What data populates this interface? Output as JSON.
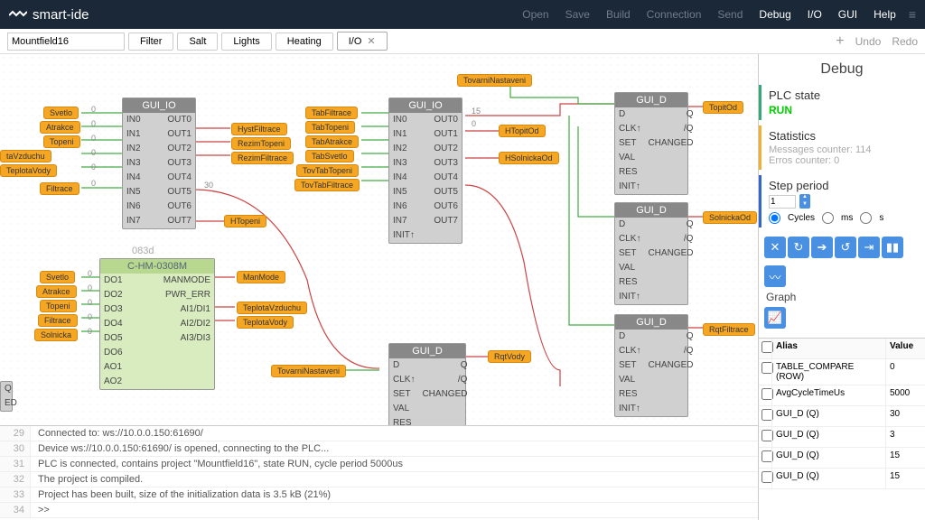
{
  "app": {
    "name": "smart-ide"
  },
  "menu": [
    "Open",
    "Save",
    "Build",
    "Connection",
    "Send",
    "Debug",
    "I/O",
    "GUI",
    "Help"
  ],
  "menu_active": "Debug",
  "project_name": "Mountfield16",
  "tabs": [
    "Filter",
    "Salt",
    "Lights",
    "Heating",
    "I/O"
  ],
  "active_tab": "I/O",
  "toolbar_right": {
    "plus": "+",
    "undo": "Undo",
    "redo": "Redo"
  },
  "blocks": {
    "gui_io_1": {
      "title": "GUI_IO",
      "left": [
        "IN0",
        "IN1",
        "IN2",
        "IN3",
        "IN4",
        "IN5",
        "IN6",
        "IN7"
      ],
      "right": [
        "OUT0",
        "OUT1",
        "OUT2",
        "OUT3",
        "OUT4",
        "OUT5",
        "OUT6",
        "OUT7"
      ]
    },
    "gui_io_2": {
      "title": "GUI_IO",
      "left": [
        "IN0",
        "IN1",
        "IN2",
        "IN3",
        "IN4",
        "IN5",
        "IN6",
        "IN7",
        "INIT↑"
      ],
      "right": [
        "OUT0",
        "OUT1",
        "OUT2",
        "OUT3",
        "OUT4",
        "OUT5",
        "OUT6",
        "OUT7",
        ""
      ]
    },
    "gui_d": {
      "title": "GUI_D",
      "left": [
        "D",
        "CLK↑",
        "SET",
        "VAL",
        "RES",
        "INIT↑"
      ],
      "right": [
        "Q",
        "/Q",
        "CHANGED",
        "",
        "",
        ""
      ]
    },
    "chm": {
      "title": "C-HM-0308M",
      "sub": "083d",
      "left": [
        "DO1",
        "DO2",
        "DO3",
        "DO4",
        "DO5",
        "DO6",
        "AO1",
        "AO2"
      ],
      "right": [
        "MANMODE",
        "PWR_ERR",
        "AI1/DI1",
        "AI2/DI2",
        "AI3/DI3",
        "",
        "",
        ""
      ]
    }
  },
  "tags_left1": [
    "Svetlo",
    "Atrakce",
    "Topeni",
    "taVzduchu",
    "TeplotaVody",
    "Filtrace"
  ],
  "tags_right1": [
    "HystFiltrace",
    "RezimTopeni",
    "RezimFiltrace"
  ],
  "tags_htop": "HTopeni",
  "tags_left2": [
    "TabFiltrace",
    "TabTopeni",
    "TabAtrakce",
    "TabSvetlo",
    "TovTabTopeni",
    "TovTabFiltrace"
  ],
  "tag_tov": "TovarniNastaveni",
  "tags_r2": [
    "HTopitOd",
    "HSolnickaOd"
  ],
  "tags_left3": [
    "Svetlo",
    "Atrakce",
    "Topeni",
    "Filtrace",
    "Solnicka"
  ],
  "tags_r3": [
    "ManMode",
    "TeplotaVzduchu",
    "TeplotaVody"
  ],
  "tag_tov2": "TovarniNastaveni",
  "tag_rqt": "RqtVody",
  "tags_gui_d": [
    "TopitOd",
    "SolnickaOd",
    "RqtFiltrace"
  ],
  "vals": {
    "v30": "30",
    "v15": "15",
    "v0": "0"
  },
  "console": [
    {
      "n": "29",
      "t": "Connected to: ws://10.0.0.150:61690/"
    },
    {
      "n": "30",
      "t": "Device ws://10.0.0.150:61690/ is opened, connecting to the PLC..."
    },
    {
      "n": "31",
      "t": "PLC is connected, contains project \"Mountfield16\", state RUN, cycle period 5000us"
    },
    {
      "n": "32",
      "t": "The project is compiled."
    },
    {
      "n": "33",
      "t": "Project has been built, size of the initialization data is 3.5 kB (21%)"
    },
    {
      "n": "34",
      "t": ">>"
    }
  ],
  "debug": {
    "title": "Debug",
    "plc_h": "PLC state",
    "plc_v": "RUN",
    "stat_h": "Statistics",
    "stat_msg": "Messages counter: 114",
    "stat_err": "Erros counter: 0",
    "step_h": "Step period",
    "step_v": "1",
    "radios": {
      "cycles": "Cycles",
      "ms": "ms",
      "s": "s"
    },
    "graph": "Graph"
  },
  "vars": {
    "head": {
      "alias": "Alias",
      "value": "Value"
    },
    "rows": [
      {
        "a": "TABLE_COMPARE (ROW)",
        "v": "0"
      },
      {
        "a": "AvgCycleTimeUs",
        "v": "5000"
      },
      {
        "a": "GUI_D (Q)",
        "v": "30"
      },
      {
        "a": "GUI_D (Q)",
        "v": "3"
      },
      {
        "a": "GUI_D (Q)",
        "v": "15"
      },
      {
        "a": "GUI_D (Q)",
        "v": "15"
      }
    ]
  }
}
